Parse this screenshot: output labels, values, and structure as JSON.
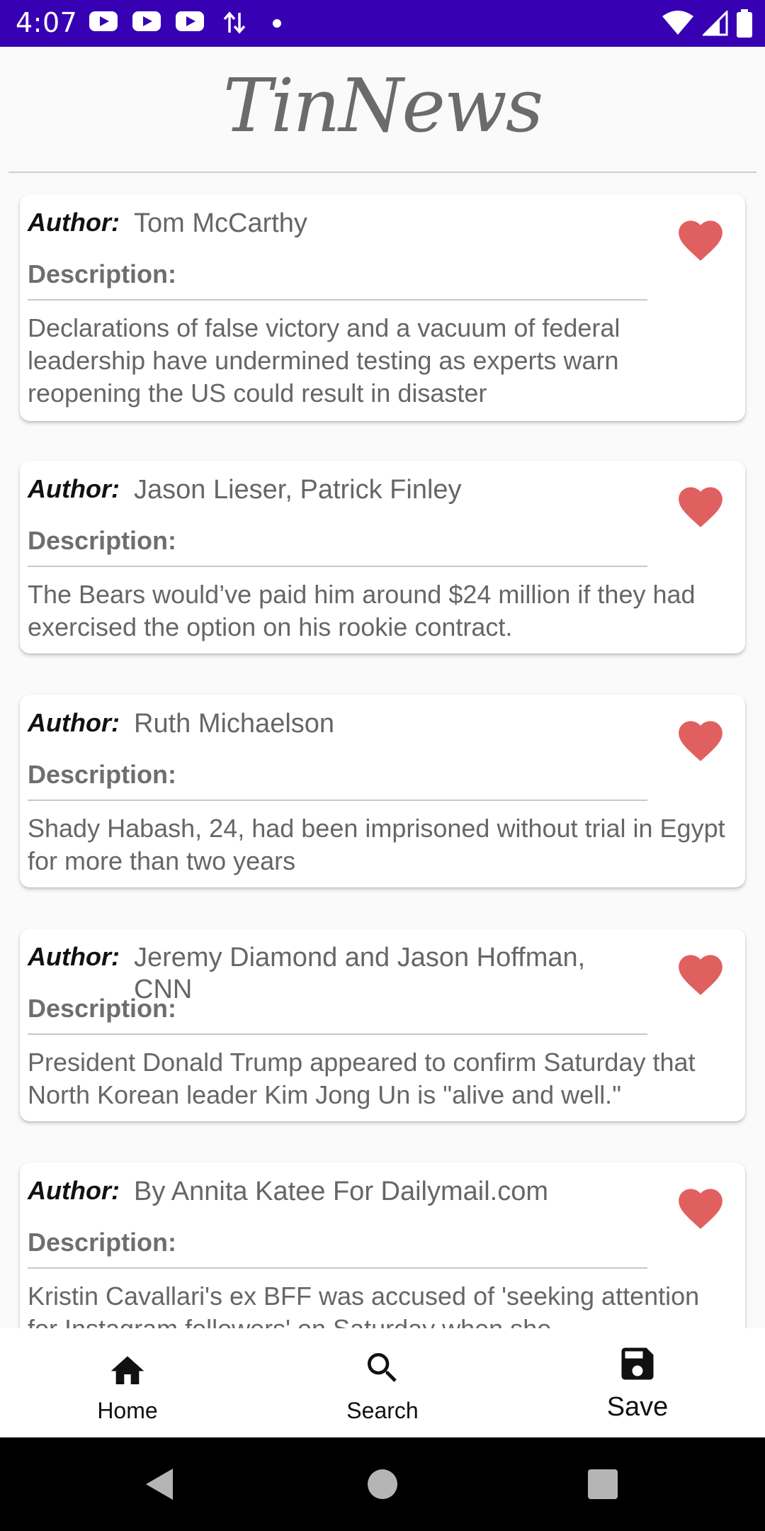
{
  "status_bar": {
    "time": "4:07",
    "icons": [
      "youtube-icon",
      "youtube-icon",
      "youtube-icon",
      "data-transfer-icon",
      "notification-dot-icon",
      "wifi-icon",
      "signal-icon",
      "battery-icon"
    ],
    "background": "#3700b3"
  },
  "header": {
    "title": "TinNews"
  },
  "labels": {
    "author": "Author:",
    "description": "Description:"
  },
  "like_color": "#e06060",
  "articles": [
    {
      "author": "Tom McCarthy",
      "description": "Declarations of false victory and a vacuum of federal leadership have undermined testing as experts warn reopening the US could result in disaster"
    },
    {
      "author": "Jason Lieser, Patrick Finley",
      "description": "The Bears would’ve paid him around $24 million if they had exercised the option on his rookie contract."
    },
    {
      "author": "Ruth Michaelson",
      "description": "Shady Habash, 24, had been imprisoned without trial in Egypt for more than two years"
    },
    {
      "author": "Jeremy Diamond and Jason Hoffman, CNN",
      "description": "President Donald Trump appeared to confirm Saturday that North Korean leader Kim Jong Un is \"alive and well.\""
    },
    {
      "author": "By Annita Katee For Dailymail.com",
      "description": "Kristin Cavallari's ex BFF was accused of 'seeking attention for Instagram followers' on Saturday when she"
    }
  ],
  "bottom_nav": {
    "items": [
      {
        "label": "Home",
        "icon": "home-icon"
      },
      {
        "label": "Search",
        "icon": "search-icon"
      },
      {
        "label": "Save",
        "icon": "save-icon",
        "selected": true
      }
    ]
  },
  "system_nav": [
    "back-icon",
    "home-circle-icon",
    "recents-icon"
  ]
}
